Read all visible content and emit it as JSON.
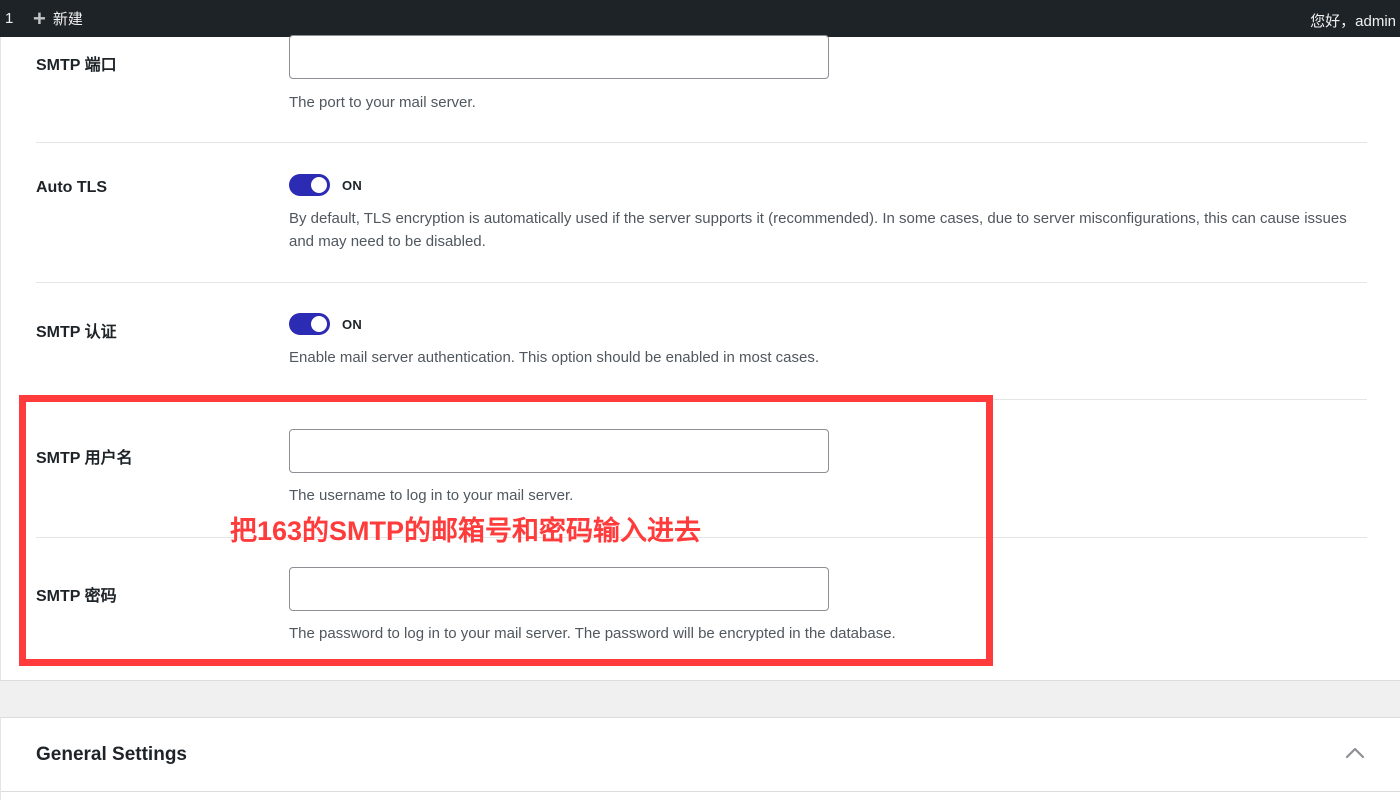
{
  "admin_bar": {
    "count": "1",
    "new_label": "新建",
    "greeting": "您好，admin"
  },
  "smtp": {
    "port": {
      "label": "SMTP 端口",
      "value": "",
      "description": "The port to your mail server."
    },
    "auto_tls": {
      "label": "Auto TLS",
      "state": "ON",
      "description": "By default, TLS encryption is automatically used if the server supports it (recommended). In some cases, due to server misconfigurations, this can cause issues and may need to be disabled."
    },
    "auth": {
      "label": "SMTP 认证",
      "state": "ON",
      "description": "Enable mail server authentication. This option should be enabled in most cases."
    },
    "username": {
      "label": "SMTP 用户名",
      "value": "",
      "description": "The username to log in to your mail server."
    },
    "password": {
      "label": "SMTP 密码",
      "value": "",
      "description": "The password to log in to your mail server. The password will be encrypted in the database."
    }
  },
  "annotation": {
    "text": "把163的SMTP的邮箱号和密码输入进去",
    "color": "#ff3b3b"
  },
  "general": {
    "title": "General Settings",
    "icon": "chevron-up-icon"
  },
  "colors": {
    "toggle_on": "#2b2bb3",
    "admin_bar_bg": "#1d2327"
  }
}
